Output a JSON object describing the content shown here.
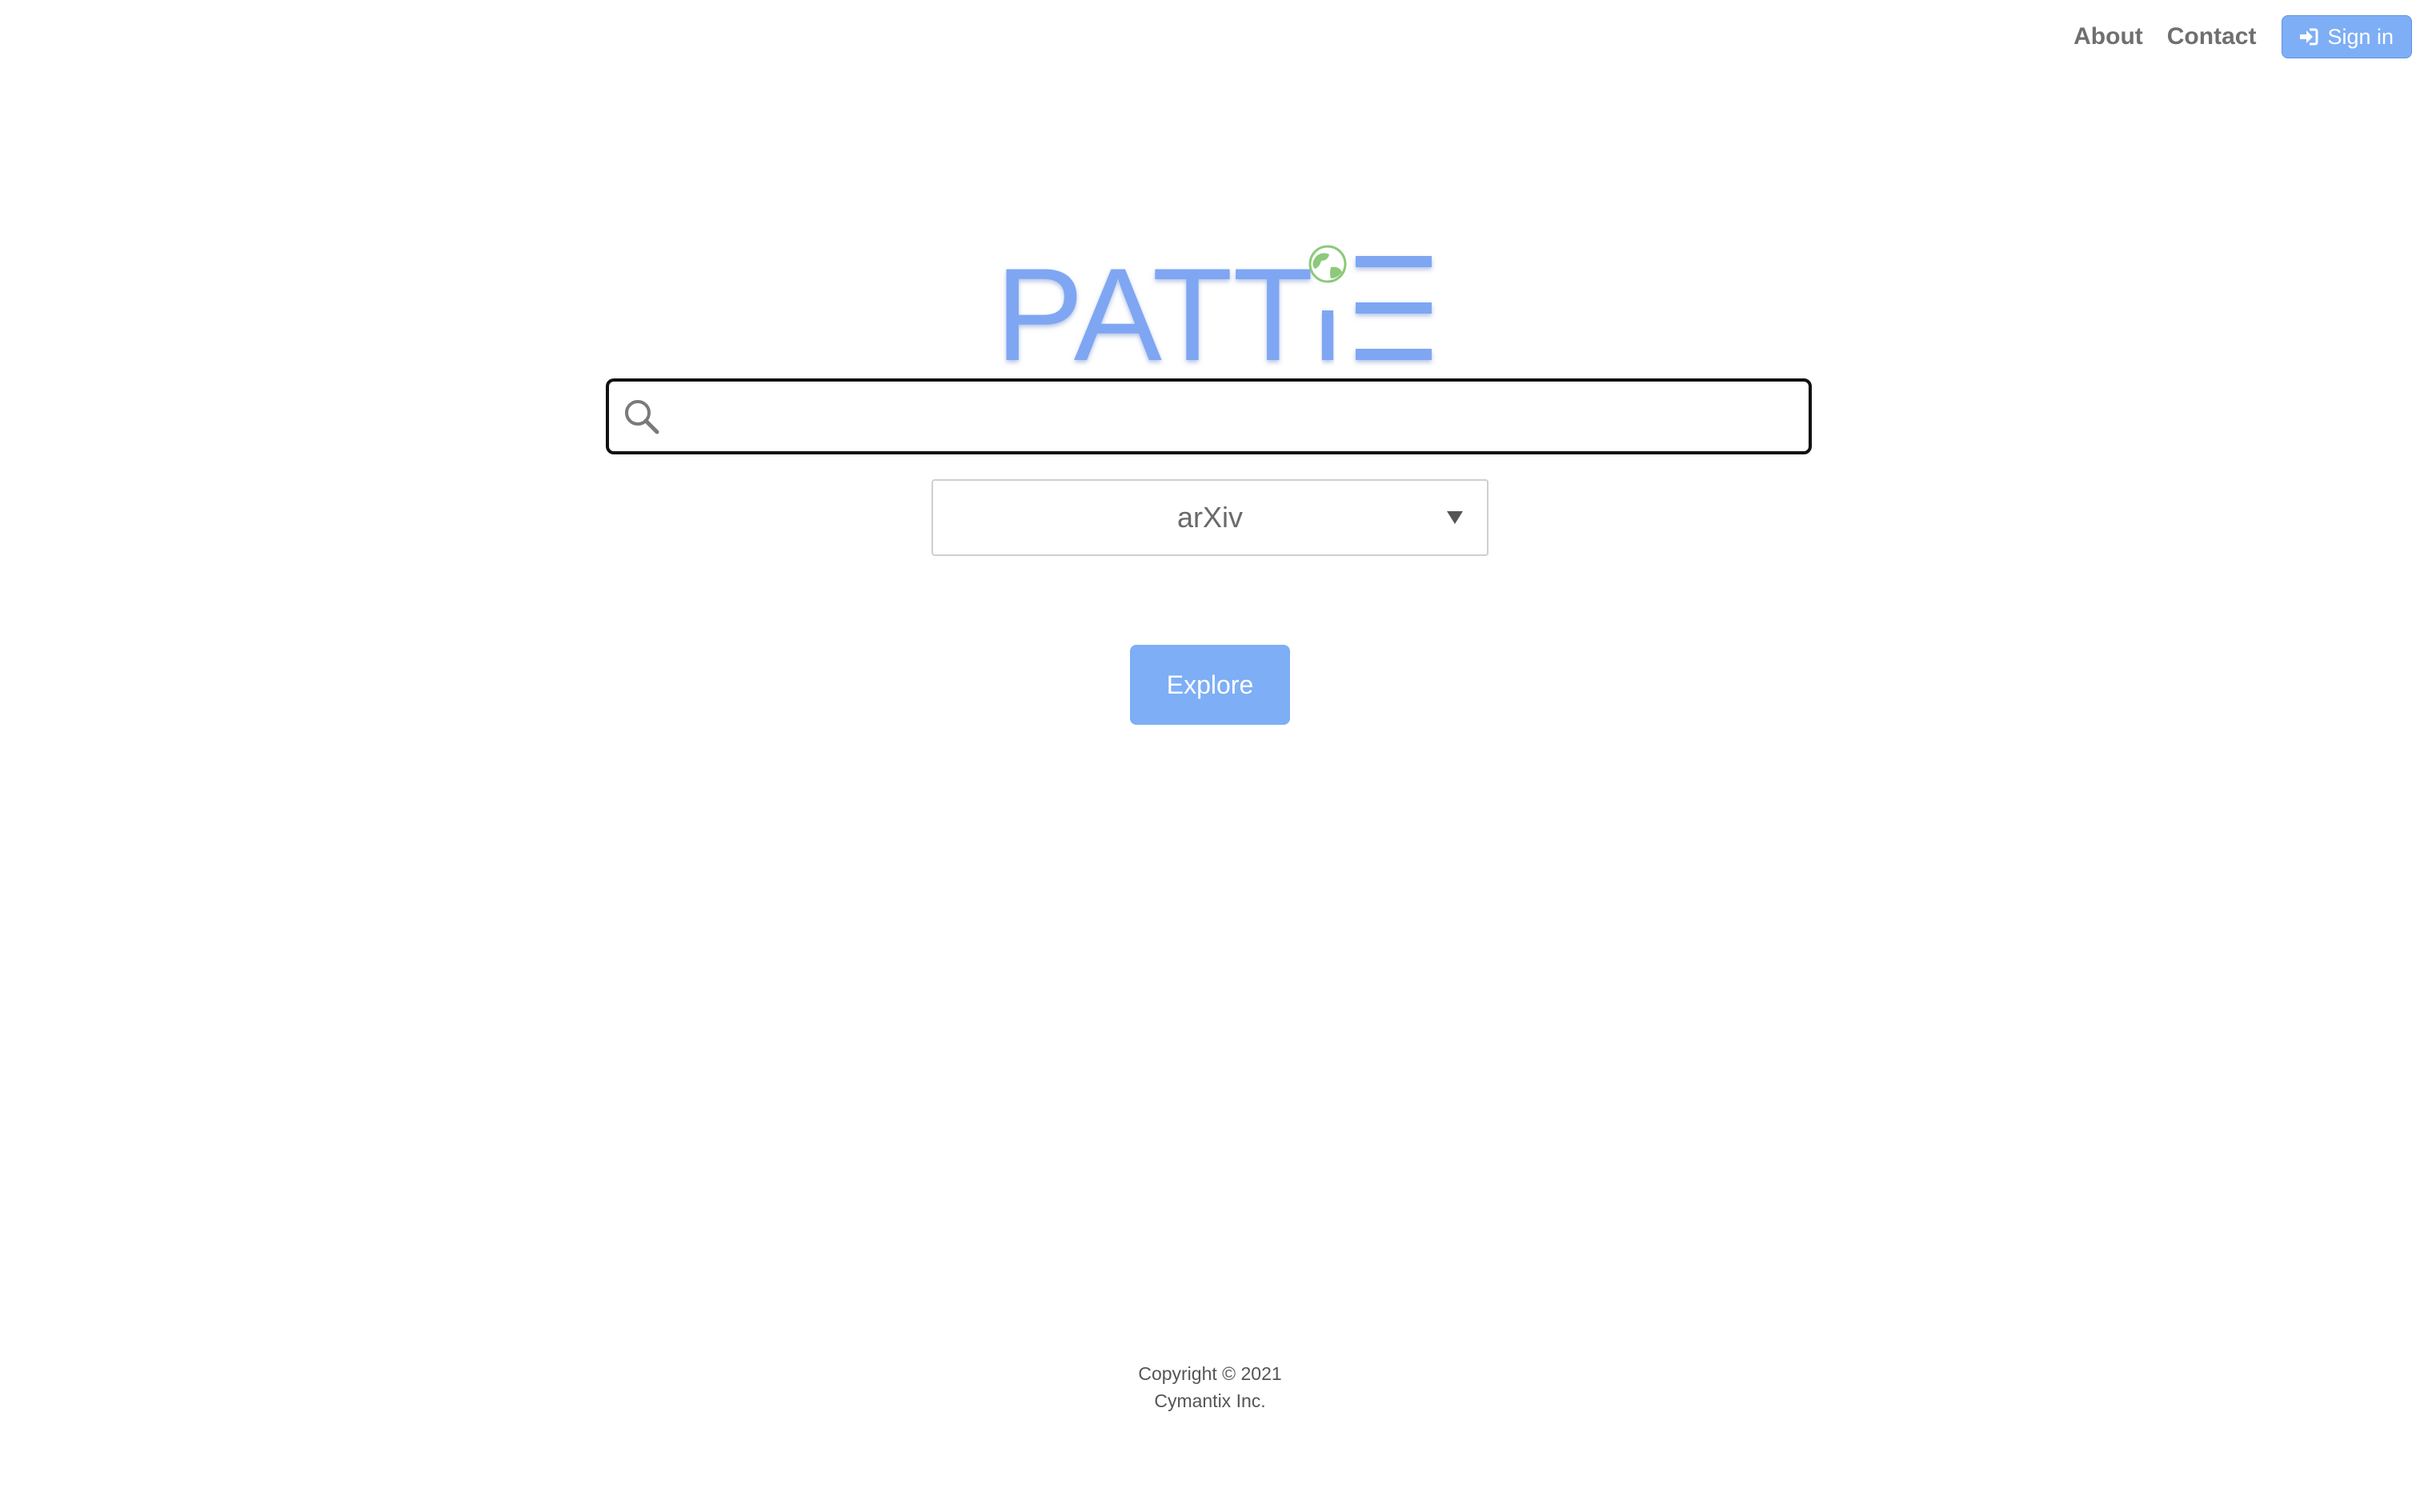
{
  "nav": {
    "about_label": "About",
    "contact_label": "Contact",
    "signin_label": "Sign in",
    "signin_icon": "sign-in-icon"
  },
  "logo": {
    "text_main": "PATT",
    "text_i": "i",
    "text_e": "E",
    "globe_icon": "globe-icon"
  },
  "search": {
    "value": "",
    "placeholder": "",
    "icon": "search-icon"
  },
  "source_select": {
    "selected": "arXiv"
  },
  "explore_label": "Explore",
  "footer": {
    "copyright": "Copyright © 2021",
    "company": "Cymantix Inc."
  },
  "colors": {
    "accent": "#7eaef5",
    "logo_blue": "#7fa6f2",
    "globe_green": "#8cc97a",
    "nav_text": "#6f6f6f"
  }
}
